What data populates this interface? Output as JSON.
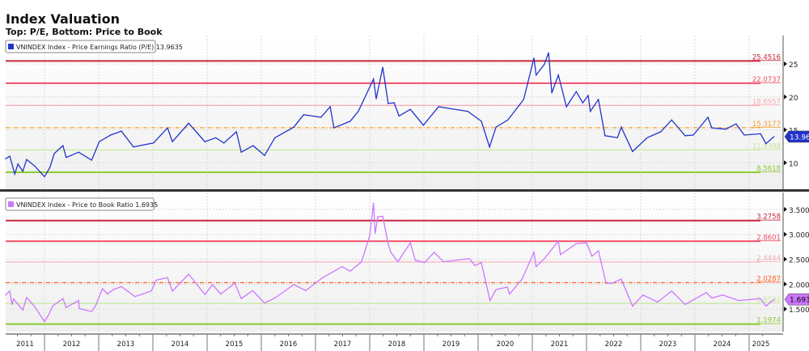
{
  "header": {
    "title": "Index Valuation",
    "subtitle": "Top: P/E, Bottom: Price to Book"
  },
  "colors": {
    "pe": "#2233cc",
    "pb": "#cc77ff",
    "plus3": "#c8283c",
    "plus2": "#f2506a",
    "plus1": "#f7a8b4",
    "mean_pe": "#f5a030",
    "mean_pb": "#ff6020",
    "minus1": "#c4e89a",
    "minus2": "#8ccc30"
  },
  "chart_data": [
    {
      "type": "line",
      "title": "VNINDEX Index - Price Earnings Ratio (P/E)",
      "legend": "VNINDEX Index - Price Earnings Ratio (P/E) 13.9635",
      "legend_position": "top-left",
      "last_value": "13.9635",
      "ylim": [
        6.5,
        27.5
      ],
      "yticks": [
        "10",
        "15",
        "20",
        "25"
      ],
      "ytick_values": [
        10,
        15,
        20,
        25
      ],
      "grid": true,
      "bands": [
        {
          "label": "25.4516",
          "value": 25.4516,
          "kind": "plus3"
        },
        {
          "label": "22.0737",
          "value": 22.0737,
          "kind": "plus2"
        },
        {
          "label": "18.6957",
          "value": 18.6957,
          "kind": "plus1"
        },
        {
          "label": "15.3177",
          "value": 15.3177,
          "kind": "mean_pe"
        },
        {
          "label": "11.9398",
          "value": 11.9398,
          "kind": "minus1"
        },
        {
          "label": "8.5618",
          "value": 8.5618,
          "kind": "minus2"
        }
      ],
      "x": [
        2011.28,
        2011.36,
        2011.45,
        2011.51,
        2011.6,
        2011.67,
        2011.82,
        2012.0,
        2012.1,
        2012.18,
        2012.34,
        2012.4,
        2012.63,
        2012.87,
        2013.01,
        2013.22,
        2013.42,
        2013.64,
        2014.01,
        2014.27,
        2014.36,
        2014.66,
        2014.96,
        2015.16,
        2015.31,
        2015.54,
        2015.63,
        2015.85,
        2016.06,
        2016.25,
        2016.6,
        2016.78,
        2017.1,
        2017.27,
        2017.34,
        2017.64,
        2017.79,
        2018.07,
        2018.12,
        2018.24,
        2018.34,
        2018.45,
        2018.54,
        2018.75,
        2018.99,
        2019.27,
        2019.81,
        2020.06,
        2020.21,
        2020.33,
        2020.55,
        2020.84,
        2021.03,
        2021.07,
        2021.22,
        2021.3,
        2021.36,
        2021.48,
        2021.63,
        2021.81,
        2021.93,
        2022.03,
        2022.07,
        2022.22,
        2022.34,
        2022.57,
        2022.64,
        2022.85,
        2023.12,
        2023.37,
        2023.57,
        2023.82,
        2023.97,
        2024.24,
        2024.31,
        2024.57,
        2024.76,
        2024.91,
        2025.21,
        2025.31,
        2025.46
      ],
      "y": [
        10.6,
        11.0,
        8.3,
        9.8,
        8.7,
        10.5,
        9.5,
        7.9,
        9.3,
        11.4,
        12.6,
        10.8,
        11.6,
        10.4,
        13.2,
        14.2,
        14.8,
        12.4,
        13.0,
        15.3,
        13.2,
        16.0,
        13.2,
        13.8,
        13.0,
        14.7,
        11.6,
        12.6,
        11.1,
        13.8,
        15.4,
        17.3,
        16.9,
        18.5,
        15.3,
        16.3,
        17.8,
        22.7,
        19.7,
        24.5,
        19.0,
        19.1,
        17.1,
        18.1,
        15.7,
        18.5,
        17.8,
        16.3,
        12.4,
        15.4,
        16.5,
        19.6,
        25.9,
        23.3,
        24.9,
        26.7,
        20.6,
        23.3,
        18.5,
        20.8,
        19.1,
        20.2,
        17.8,
        19.6,
        14.1,
        13.8,
        15.4,
        11.7,
        13.8,
        14.7,
        16.5,
        14.1,
        14.2,
        16.9,
        15.3,
        15.1,
        15.9,
        14.2,
        14.4,
        12.9,
        13.9635
      ]
    },
    {
      "type": "line",
      "title": "VNINDEX Index - Price to Book Ratio",
      "legend": "VNINDEX Index - Price to Book Ratio 1.6935",
      "legend_position": "top-left",
      "last_value": "1.6935",
      "ylim": [
        1.05,
        3.7
      ],
      "yticks": [
        "1.5000",
        "2.0000",
        "2.5000",
        "3.0000",
        "3.5000"
      ],
      "ytick_values": [
        1.5,
        2.0,
        2.5,
        3.0,
        3.5
      ],
      "grid": true,
      "bands": [
        {
          "label": "3.2758",
          "value": 3.2758,
          "kind": "plus3"
        },
        {
          "label": "2.8601",
          "value": 2.8601,
          "kind": "plus2"
        },
        {
          "label": "2.4444",
          "value": 2.4444,
          "kind": "plus1"
        },
        {
          "label": "2.0287",
          "value": 2.0287,
          "kind": "mean_pb"
        },
        {
          "label": "1.6131",
          "value": 1.6131,
          "kind": "minus1"
        },
        {
          "label": "1.1974",
          "value": 1.1974,
          "kind": "minus2"
        }
      ],
      "x": [
        2011.28,
        2011.36,
        2011.4,
        2011.43,
        2011.6,
        2011.67,
        2011.81,
        2012.0,
        2012.07,
        2012.15,
        2012.34,
        2012.4,
        2012.63,
        2012.64,
        2012.87,
        2012.94,
        2013.07,
        2013.16,
        2013.27,
        2013.42,
        2013.67,
        2013.97,
        2014.06,
        2014.27,
        2014.36,
        2014.66,
        2014.96,
        2015.1,
        2015.25,
        2015.51,
        2015.63,
        2015.84,
        2016.06,
        2016.25,
        2016.6,
        2016.82,
        2017.12,
        2017.49,
        2017.64,
        2017.85,
        2018.0,
        2018.07,
        2018.1,
        2018.15,
        2018.24,
        2018.34,
        2018.39,
        2018.52,
        2018.75,
        2018.84,
        2019.01,
        2019.19,
        2019.36,
        2019.84,
        2019.94,
        2020.06,
        2020.22,
        2020.33,
        2020.54,
        2020.58,
        2020.81,
        2021.03,
        2021.07,
        2021.22,
        2021.48,
        2021.52,
        2021.81,
        2022.0,
        2022.1,
        2022.22,
        2022.36,
        2022.48,
        2022.64,
        2022.85,
        2023.04,
        2023.31,
        2023.57,
        2023.82,
        2024.21,
        2024.31,
        2024.51,
        2024.81,
        2025.21,
        2025.31,
        2025.46
      ],
      "y": [
        1.78,
        1.86,
        1.59,
        1.7,
        1.48,
        1.73,
        1.56,
        1.25,
        1.37,
        1.56,
        1.71,
        1.53,
        1.67,
        1.51,
        1.45,
        1.56,
        1.91,
        1.8,
        1.89,
        1.95,
        1.75,
        1.86,
        2.08,
        2.13,
        1.86,
        2.2,
        1.79,
        1.99,
        1.8,
        2.02,
        1.71,
        1.87,
        1.62,
        1.72,
        1.99,
        1.87,
        2.12,
        2.35,
        2.26,
        2.45,
        2.97,
        3.62,
        3.02,
        3.35,
        3.36,
        2.81,
        2.64,
        2.45,
        2.83,
        2.48,
        2.43,
        2.64,
        2.45,
        2.51,
        2.37,
        2.43,
        1.67,
        1.89,
        1.94,
        1.8,
        2.1,
        2.64,
        2.35,
        2.51,
        2.86,
        2.59,
        2.81,
        2.83,
        2.56,
        2.67,
        2.02,
        2.02,
        2.1,
        1.56,
        1.78,
        1.64,
        1.86,
        1.59,
        1.83,
        1.72,
        1.78,
        1.67,
        1.71,
        1.56,
        1.6935
      ]
    }
  ],
  "xaxis": {
    "labels": [
      "2011",
      "2012",
      "2013",
      "2014",
      "2015",
      "2016",
      "2017",
      "2018",
      "2019",
      "2020",
      "2021",
      "2022",
      "2023",
      "2024",
      "2025"
    ]
  }
}
